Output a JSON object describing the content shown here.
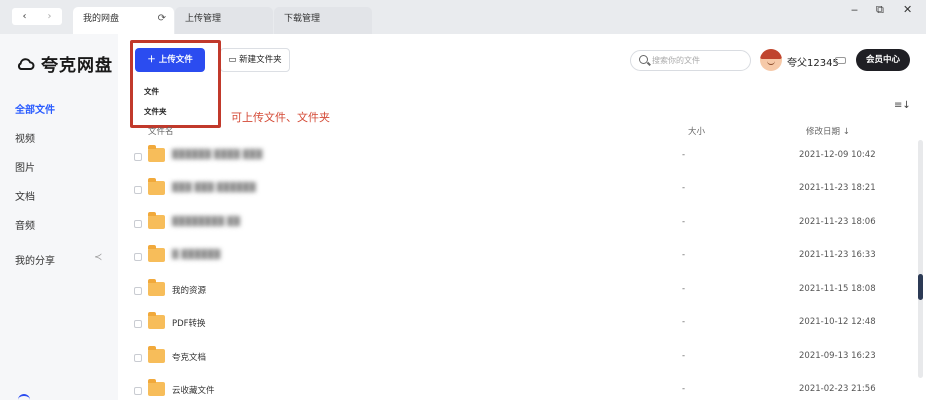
{
  "titlebar": {
    "nav_back": "‹",
    "nav_forward": "›",
    "tabs": [
      {
        "label": "我的网盘",
        "reload": "⟳"
      },
      {
        "label": "上传管理"
      },
      {
        "label": "下载管理"
      }
    ],
    "window_controls": {
      "minimize": "‒",
      "maximize": "⧉",
      "close": "✕"
    }
  },
  "sidebar": {
    "logo_icon": "cloud-icon",
    "logo_text": "夸克网盘",
    "items": [
      {
        "label": "全部文件",
        "active": true
      },
      {
        "label": "视频"
      },
      {
        "label": "图片"
      },
      {
        "label": "文档"
      },
      {
        "label": "音频"
      },
      {
        "label": "我的分享",
        "icon": "share-icon",
        "icon_glyph": "≺"
      }
    ]
  },
  "toolbar": {
    "upload_label": "＋ 上传文件",
    "new_folder_label": "新建文件夹",
    "new_folder_icon": "folder-outline-icon",
    "upload_menu": [
      "文件",
      "文件夹"
    ],
    "search_placeholder": "搜索你的文件",
    "username": "夸父12345",
    "member_label": "会员中心",
    "sort_icon": "≡↓"
  },
  "annotation": {
    "text": "可上传文件、文件夹",
    "color": "#c1392b"
  },
  "table": {
    "columns": [
      "文件名",
      "大小",
      "修改日期 ↓"
    ],
    "rows": [
      {
        "name": "██████ ████ ███",
        "blurred": true,
        "size": "-",
        "date": "2021-12-09 10:42"
      },
      {
        "name": "███ ███ ██████",
        "blurred": true,
        "size": "-",
        "date": "2021-11-23 18:21"
      },
      {
        "name": "████████ ██",
        "blurred": true,
        "size": "-",
        "date": "2021-11-23 18:06"
      },
      {
        "name": "█ ██████",
        "blurred": true,
        "size": "-",
        "date": "2021-11-23 16:33"
      },
      {
        "name": "我的资源",
        "blurred": false,
        "size": "-",
        "date": "2021-11-15 18:08"
      },
      {
        "name": "PDF转换",
        "blurred": false,
        "size": "-",
        "date": "2021-10-12 12:48"
      },
      {
        "name": "夸克文档",
        "blurred": false,
        "size": "-",
        "date": "2021-09-13 16:23"
      },
      {
        "name": "云收藏文件",
        "blurred": false,
        "size": "-",
        "date": "2021-02-23 21:56"
      }
    ]
  },
  "colors": {
    "accent": "#2b4cf0",
    "member_button": "#1f1f24",
    "folder": "#f7bd5a",
    "highlight": "#c1392b"
  }
}
